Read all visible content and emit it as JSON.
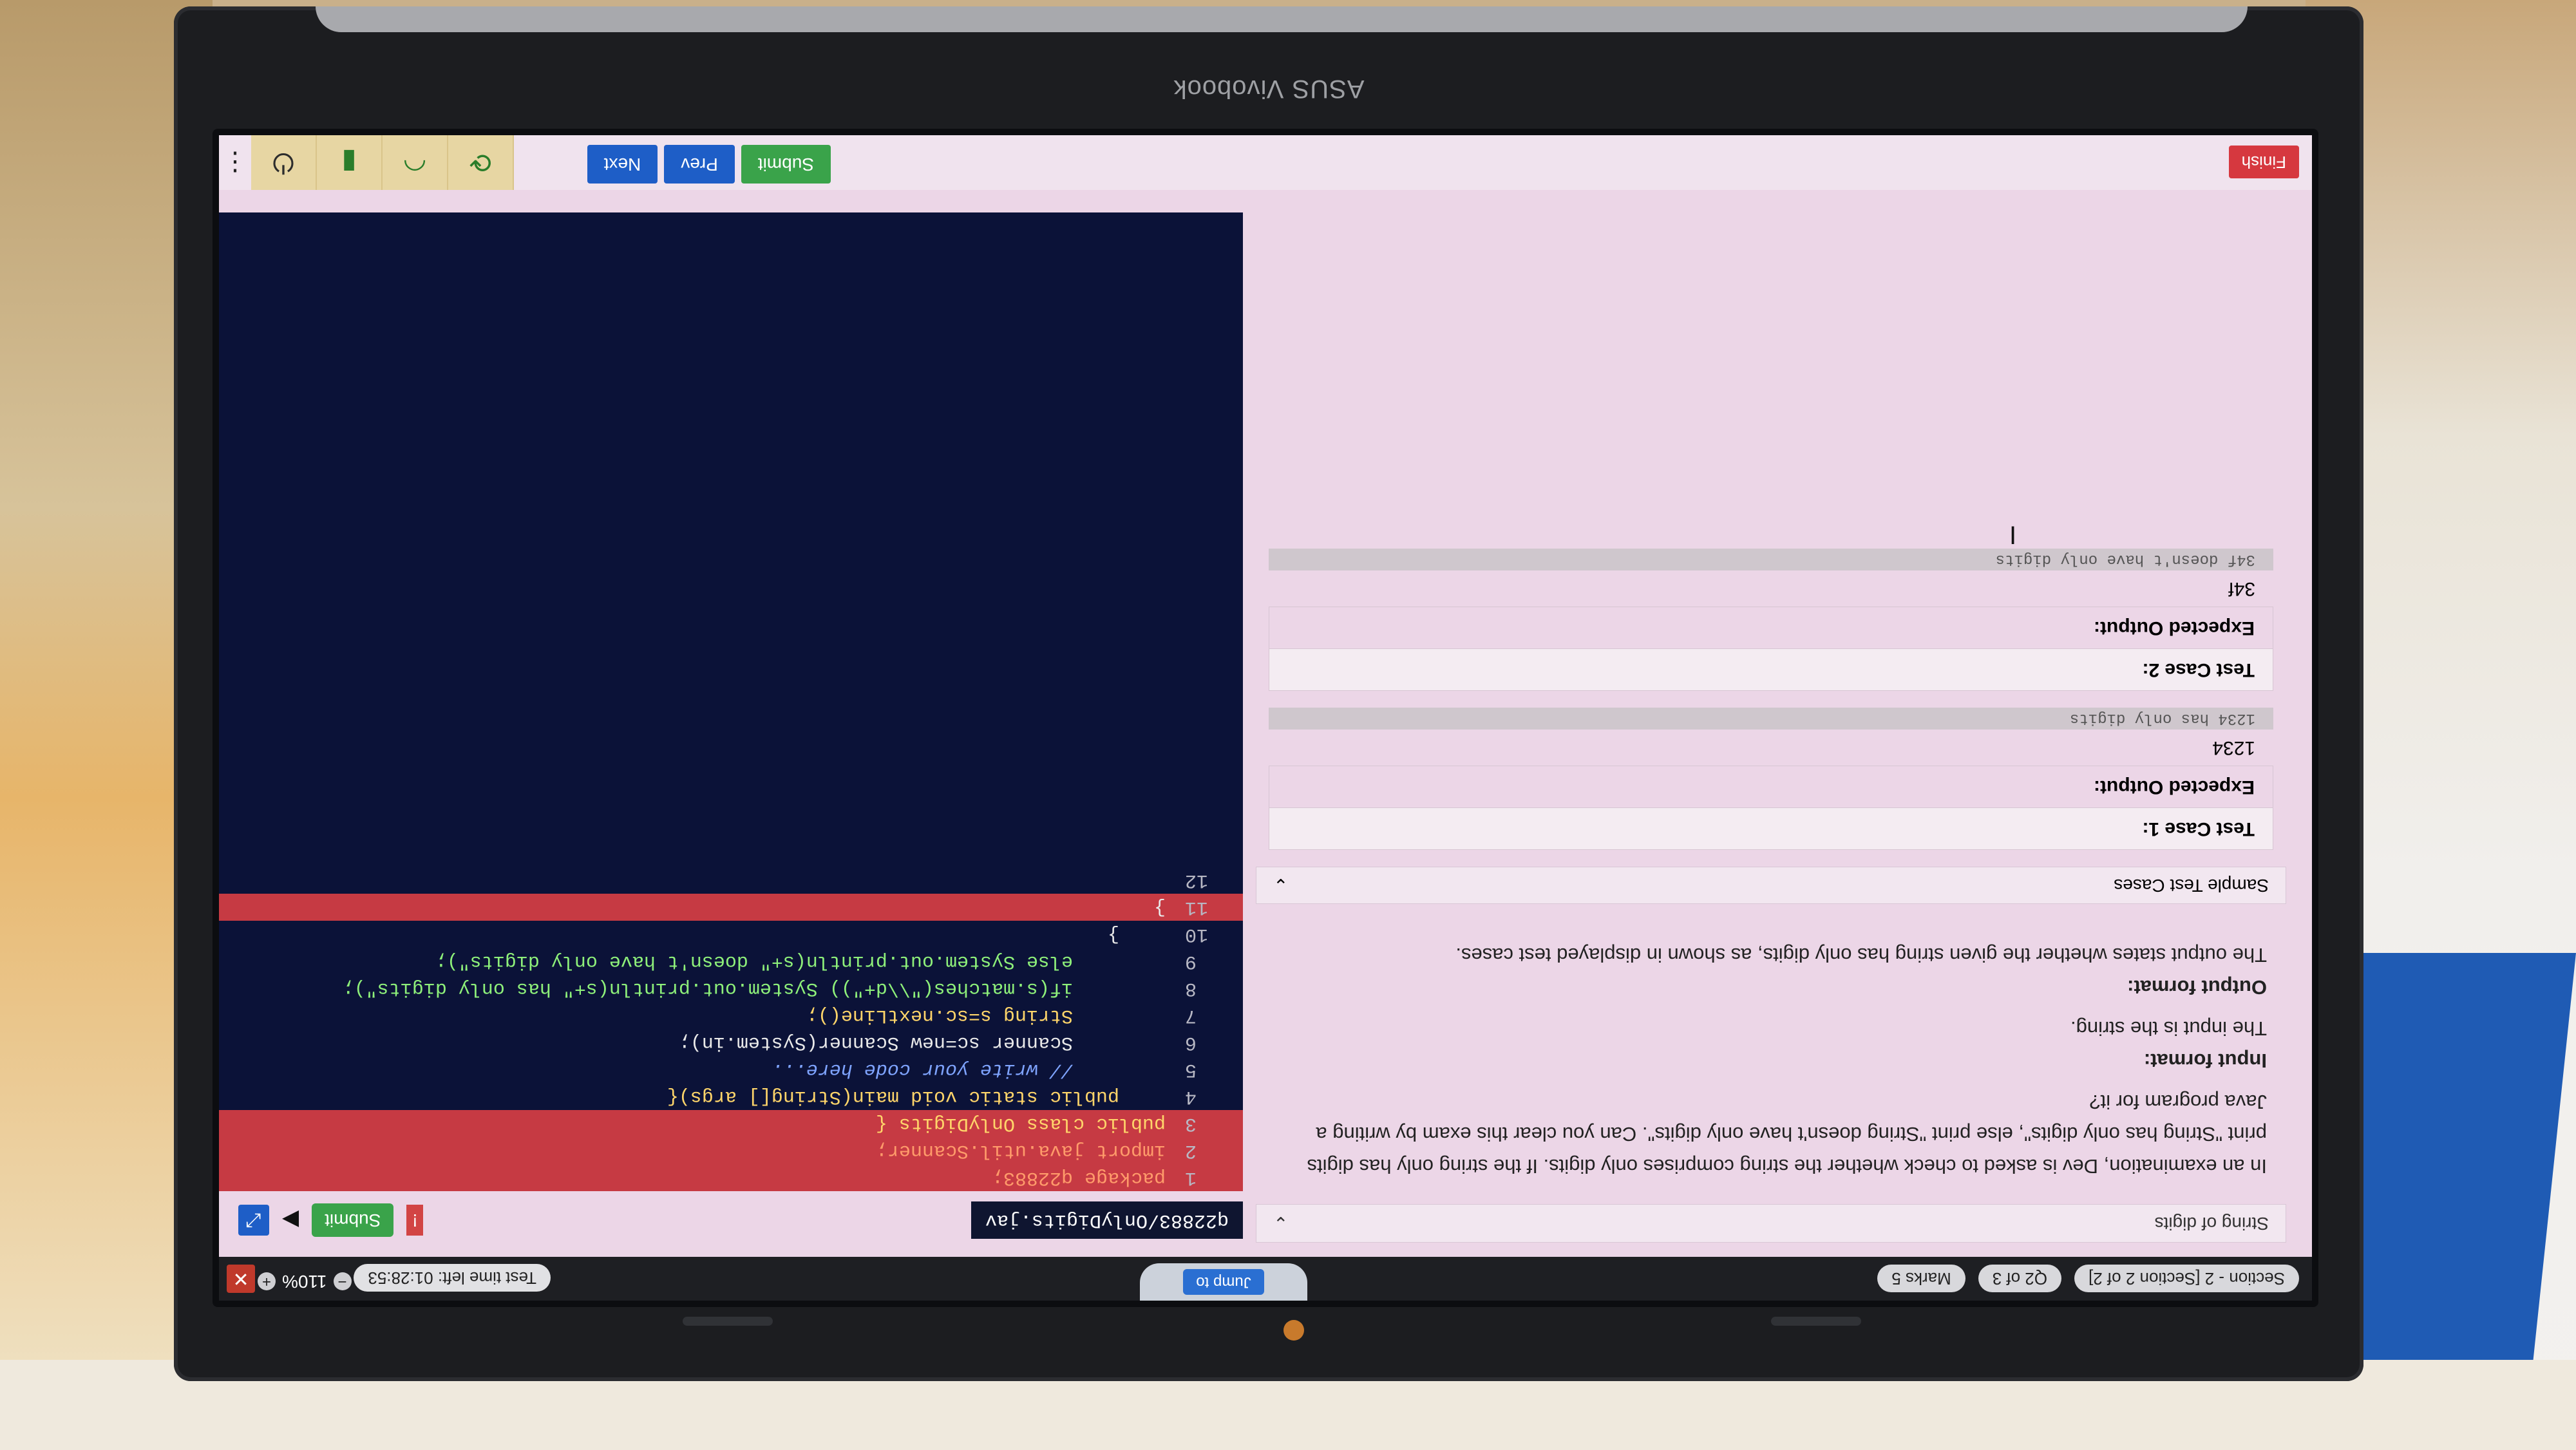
{
  "device": {
    "brand": "ASUS Vivobook"
  },
  "top_bar": {
    "pills": [
      "Section - 2 [Section 2 of 2]",
      "Q2 of 3",
      "Marks 5"
    ],
    "jump_label": "Jump to",
    "timer": "Test time left: 01:28:53",
    "zoom": "110%",
    "zoom_minus": "−",
    "zoom_plus": "+",
    "close": "✕"
  },
  "question": {
    "title": "String of digits",
    "paragraph": "In an examination, Dev is asked to check whether the string comprises only digits. If the string only has digits print \"String has only digits\", else print \"String doesn't have only digits\". Can you clear this exam by writing a Java program for it?",
    "input_heading": "Input format:",
    "input_text": "The input is the string.",
    "output_heading": "Output format:",
    "output_text": "The output states whether the given string has only digits, as shown in displayed test cases."
  },
  "sample_cases": {
    "header": "Sample Test Cases",
    "cases": [
      {
        "title": "Test Case 1:",
        "input": "",
        "expected_label": "Expected Output:",
        "value": "1234",
        "output": "1234 has only digits"
      },
      {
        "title": "Test Case 2:",
        "input": "",
        "expected_label": "Expected Output:",
        "value": "34f",
        "output": "34f doesn't have only digits"
      }
    ]
  },
  "editor": {
    "file": "q22883/OnlyDigits.jav",
    "submit_label": "Submit",
    "lines": [
      {
        "n": "1",
        "code": "package q22883;"
      },
      {
        "n": "2",
        "code": "import java.util.Scanner;"
      },
      {
        "n": "3",
        "code": "public class OnlyDigits {"
      },
      {
        "n": "4",
        "code": "    public static void main(String[] args){"
      },
      {
        "n": "5",
        "code": "        // write your code here..."
      },
      {
        "n": "6",
        "code": "        Scanner sc=new Scanner(System.in);"
      },
      {
        "n": "7",
        "code": "        String s=sc.nextLine();"
      },
      {
        "n": "8",
        "code": "        if(s.matches(\"\\\\d+\")) System.out.println(s+\" has only digits\");"
      },
      {
        "n": "9",
        "code": "        else System.out.println(s+\" doesn't have only digits\");"
      },
      {
        "n": "10",
        "code": "    }"
      },
      {
        "n": "11",
        "code": "}"
      },
      {
        "n": "12",
        "code": ""
      }
    ]
  },
  "bottom_bar": {
    "finish": "Finish",
    "submit": "Submit",
    "prev": "Prev",
    "next": "Next"
  }
}
